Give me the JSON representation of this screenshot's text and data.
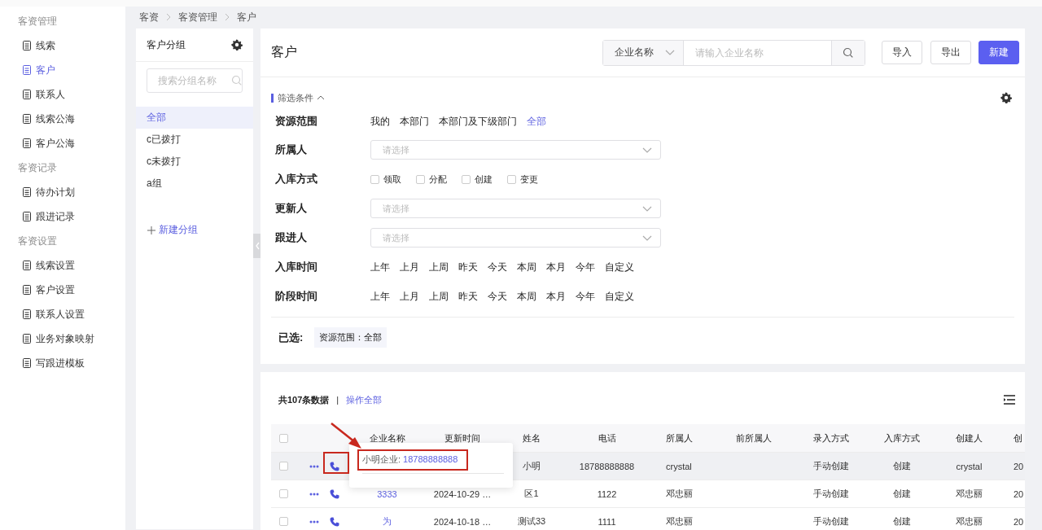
{
  "sidebar": {
    "sections": [
      {
        "title": "客资管理",
        "items": [
          {
            "label": "线索",
            "selected": false
          },
          {
            "label": "客户",
            "selected": true
          },
          {
            "label": "联系人",
            "selected": false
          },
          {
            "label": "线索公海",
            "selected": false
          },
          {
            "label": "客户公海",
            "selected": false
          }
        ]
      },
      {
        "title": "客资记录",
        "items": [
          {
            "label": "待办计划",
            "selected": false
          },
          {
            "label": "跟进记录",
            "selected": false
          }
        ]
      },
      {
        "title": "客资设置",
        "items": [
          {
            "label": "线索设置",
            "selected": false
          },
          {
            "label": "客户设置",
            "selected": false
          },
          {
            "label": "联系人设置",
            "selected": false
          },
          {
            "label": "业务对象映射",
            "selected": false
          },
          {
            "label": "写跟进模板",
            "selected": false
          }
        ]
      }
    ]
  },
  "breadcrumb": [
    "客资",
    "客资管理",
    "客户"
  ],
  "groups": {
    "title": "客户分组",
    "search_placeholder": "搜索分组名称",
    "items": [
      {
        "label": "全部",
        "selected": true
      },
      {
        "label": "c已拨打",
        "selected": false
      },
      {
        "label": "c未拨打",
        "selected": false
      },
      {
        "label": "a组",
        "selected": false
      }
    ],
    "add_label": "新建分组"
  },
  "header": {
    "title": "客户",
    "search": {
      "field": "企业名称",
      "placeholder": "请输入企业名称"
    },
    "buttons": [
      {
        "label": "导入",
        "kind": "default"
      },
      {
        "label": "导出",
        "kind": "default"
      },
      {
        "label": "新建",
        "kind": "primary"
      }
    ]
  },
  "filters": {
    "title": "筛选条件",
    "expanded": true,
    "rows": [
      {
        "label": "资源范围",
        "kind": "options",
        "options": [
          {
            "label": "我的",
            "selected": false
          },
          {
            "label": "本部门",
            "selected": false
          },
          {
            "label": "本部门及下级部门",
            "selected": false
          },
          {
            "label": "全部",
            "selected": true
          }
        ]
      },
      {
        "label": "所属人",
        "kind": "select",
        "placeholder": "请选择"
      },
      {
        "label": "入库方式",
        "kind": "checkboxes",
        "options": [
          {
            "label": "领取",
            "checked": false
          },
          {
            "label": "分配",
            "checked": false
          },
          {
            "label": "创建",
            "checked": false
          },
          {
            "label": "变更",
            "checked": false
          }
        ]
      },
      {
        "label": "更新人",
        "kind": "select",
        "placeholder": "请选择"
      },
      {
        "label": "跟进人",
        "kind": "select",
        "placeholder": "请选择"
      },
      {
        "label": "入库时间",
        "kind": "options",
        "options": [
          {
            "label": "上年",
            "selected": false
          },
          {
            "label": "上月",
            "selected": false
          },
          {
            "label": "上周",
            "selected": false
          },
          {
            "label": "昨天",
            "selected": false
          },
          {
            "label": "今天",
            "selected": false
          },
          {
            "label": "本周",
            "selected": false
          },
          {
            "label": "本月",
            "selected": false
          },
          {
            "label": "今年",
            "selected": false
          },
          {
            "label": "自定义",
            "selected": false
          }
        ]
      },
      {
        "label": "阶段时间",
        "kind": "options",
        "options": [
          {
            "label": "上年",
            "selected": false
          },
          {
            "label": "上月",
            "selected": false
          },
          {
            "label": "上周",
            "selected": false
          },
          {
            "label": "昨天",
            "selected": false
          },
          {
            "label": "今天",
            "selected": false
          },
          {
            "label": "本周",
            "selected": false
          },
          {
            "label": "本月",
            "selected": false
          },
          {
            "label": "今年",
            "selected": false
          },
          {
            "label": "自定义",
            "selected": false
          }
        ]
      }
    ],
    "chosen_label": "已选:",
    "chosen": [
      "资源范围：全部"
    ]
  },
  "table": {
    "all_checked": false,
    "summary": "共107条数据",
    "separator": "|",
    "action": "操作全部",
    "columns": [
      "企业名称",
      "更新时间",
      "姓名",
      "电话",
      "所属人",
      "前所属人",
      "录入方式",
      "入库方式",
      "创建人",
      "创"
    ],
    "rows": [
      {
        "checked": false,
        "highlighted": true,
        "cells": [
          null,
          null,
          "小明",
          "18788888888",
          "crystal",
          null,
          "手动创建",
          "创建",
          "crystal",
          "20"
        ]
      },
      {
        "checked": false,
        "highlighted": false,
        "cells": [
          "3333",
          "2024-10-29 …",
          "区1",
          "1122",
          "邓忠丽",
          null,
          "手动创建",
          "创建",
          "邓忠丽",
          "20"
        ]
      },
      {
        "checked": false,
        "highlighted": false,
        "cells": [
          "为",
          "2024-10-18 …",
          "测试33",
          "1111",
          "邓忠丽",
          null,
          "手动创建",
          "创建",
          "邓忠丽",
          "20"
        ]
      }
    ],
    "popover": {
      "label": "小明企业:",
      "phone": "18788888888"
    }
  }
}
